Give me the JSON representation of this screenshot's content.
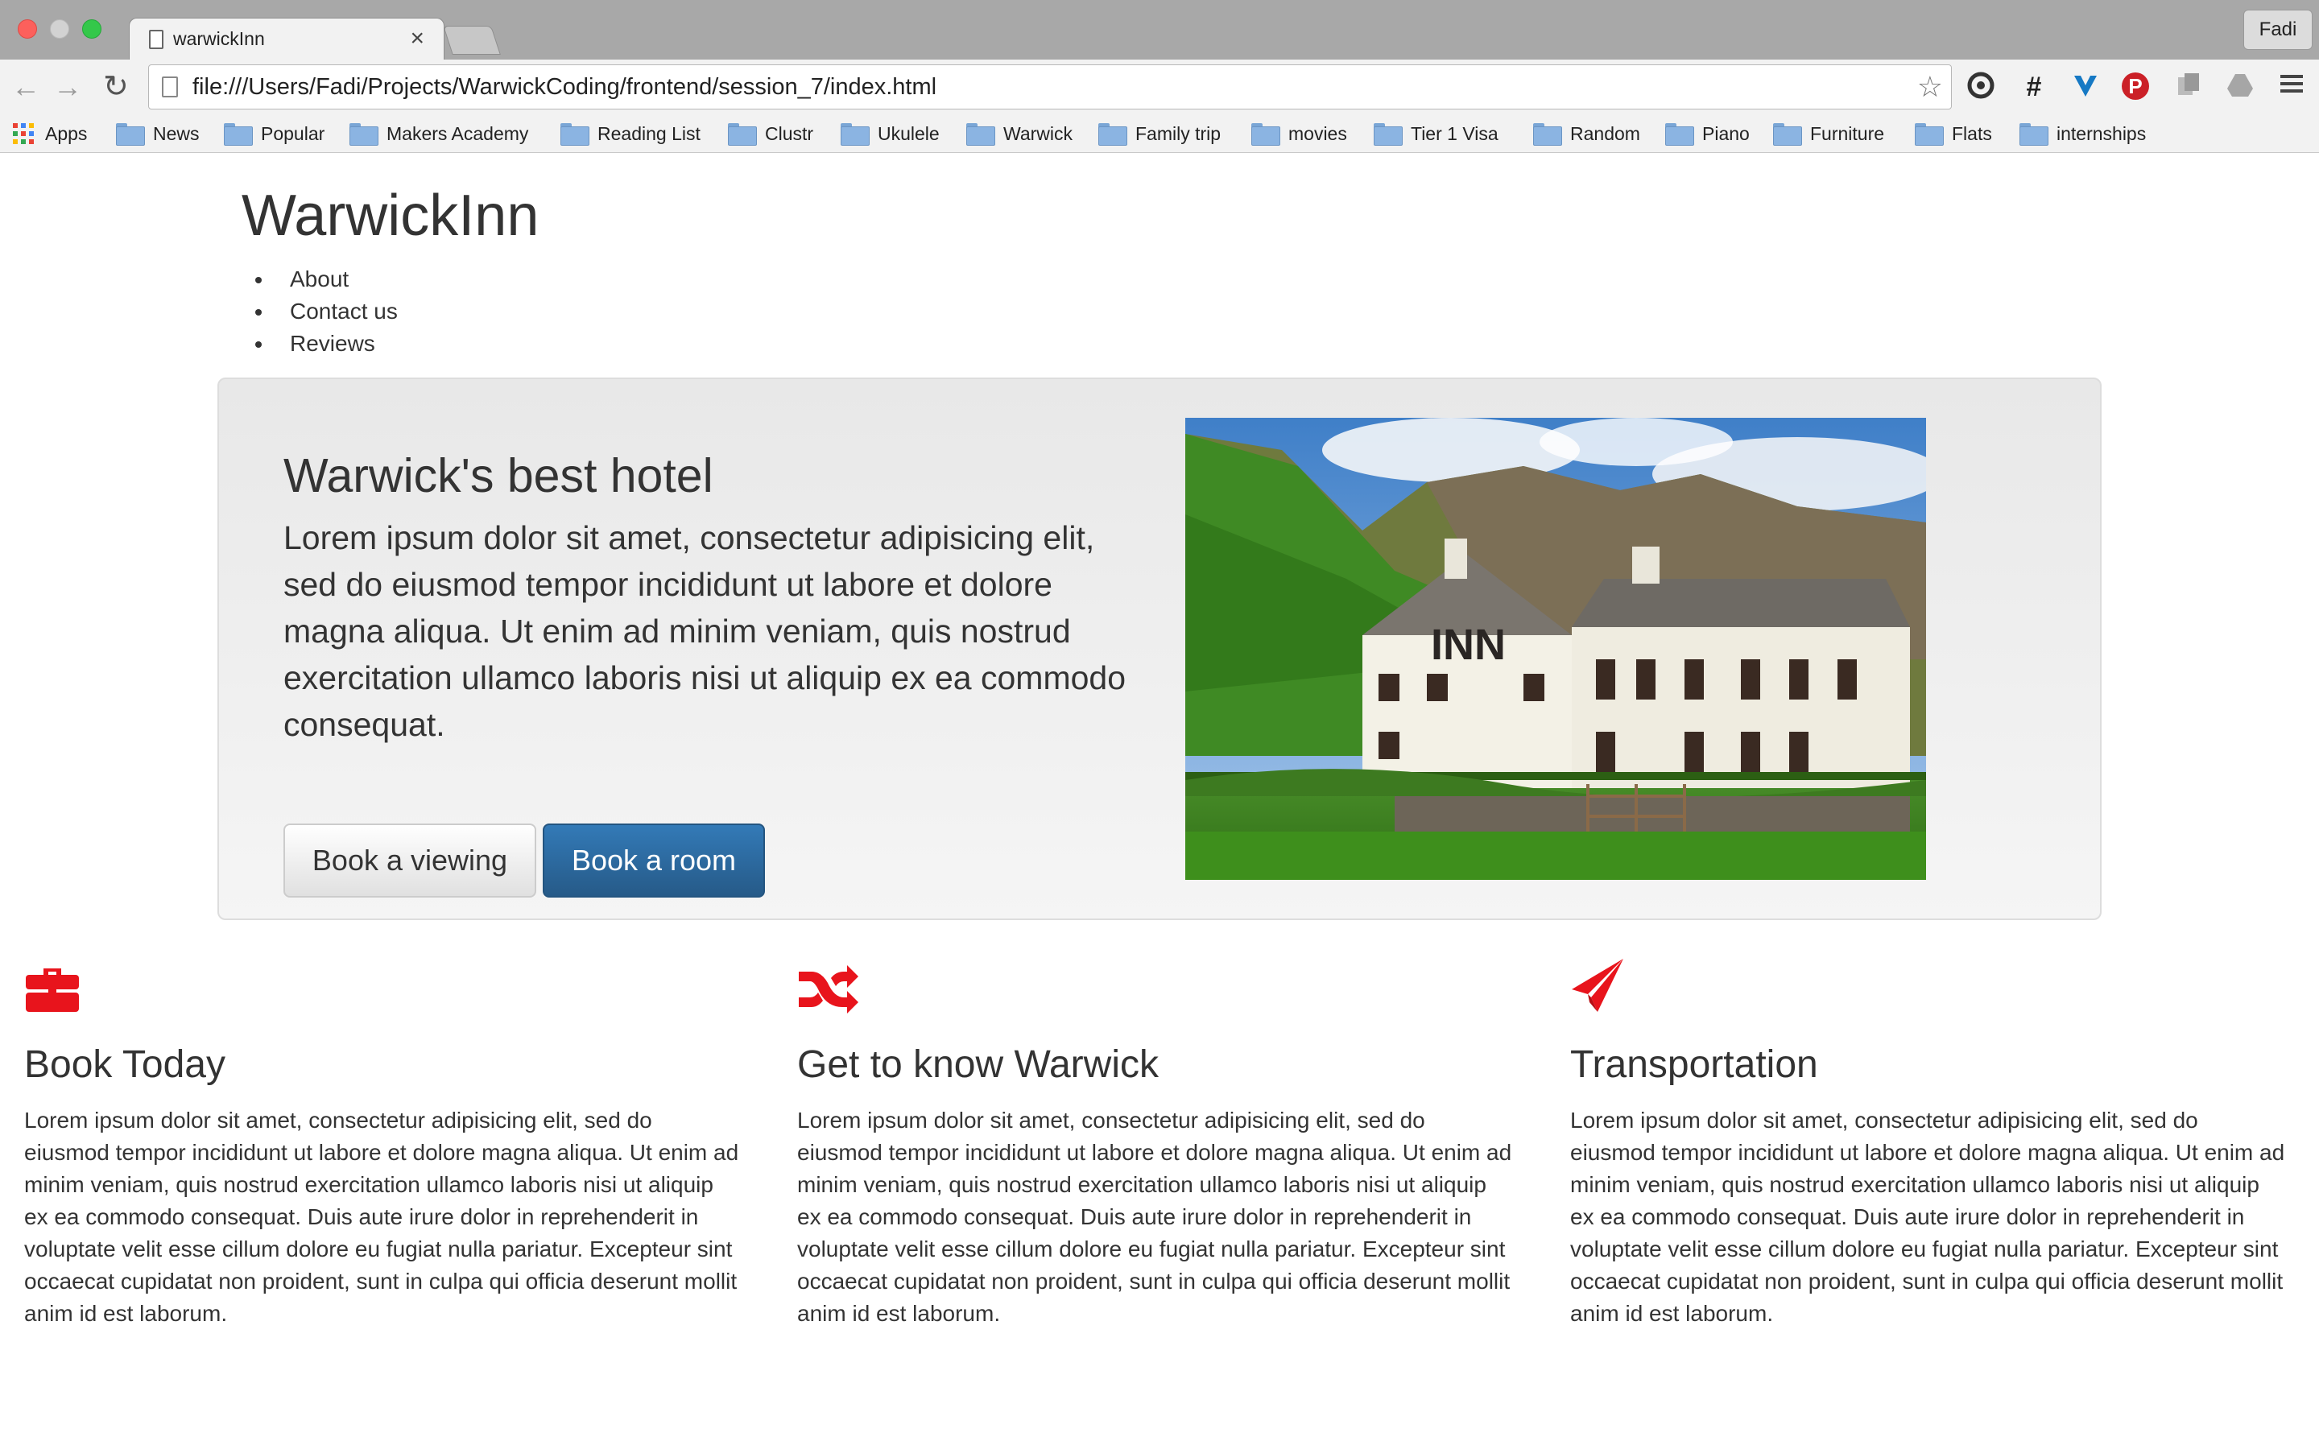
{
  "browser": {
    "tab_title": "warwickInn",
    "tab_close": "×",
    "profile_name": "Fadi",
    "url": "file:///Users/Fadi/Projects/WarwickCoding/frontend/session_7/index.html",
    "nav_icons": {
      "back": "←",
      "forward": "→",
      "reload": "↻",
      "star": "☆"
    },
    "extension_icons": [
      "circle-ext-icon",
      "hashtag-icon",
      "heart-ext-icon",
      "pinterest-icon",
      "copy-icon",
      "drive-icon",
      "menu-icon"
    ],
    "bookmarks": [
      "Apps",
      "News",
      "Popular",
      "Makers Academy",
      "Reading List",
      "Clustr",
      "Ukulele",
      "Warwick",
      "Family trip",
      "movies",
      "Tier 1 Visa",
      "Random",
      "Piano",
      "Furniture",
      "Flats",
      "internships"
    ]
  },
  "site": {
    "title": "WarwickInn",
    "nav": [
      "About",
      "Contact us",
      "Reviews"
    ]
  },
  "hero": {
    "heading": "Warwick's best hotel",
    "text": "Lorem ipsum dolor sit amet, consectetur adipisicing elit, sed do eiusmod tempor incididunt ut labore et dolore magna aliqua. Ut enim ad minim veniam, quis nostrud exercitation ullamco laboris nisi ut aliquip ex ea commodo consequat.",
    "btn_viewing": "Book a viewing",
    "btn_room": "Book a room",
    "image_sign": "INN"
  },
  "features": [
    {
      "icon": "briefcase-icon",
      "heading": "Book Today",
      "text": "Lorem ipsum dolor sit amet, consectetur adipisicing elit, sed do eiusmod tempor incididunt ut labore et dolore magna aliqua. Ut enim ad minim veniam, quis nostrud exercitation ullamco laboris nisi ut aliquip ex ea commodo consequat. Duis aute irure dolor in reprehenderit in voluptate velit esse cillum dolore eu fugiat nulla pariatur. Excepteur sint occaecat cupidatat non proident, sunt in culpa qui officia deserunt mollit anim id est laborum."
    },
    {
      "icon": "shuffle-icon",
      "heading": "Get to know Warwick",
      "text": "Lorem ipsum dolor sit amet, consectetur adipisicing elit, sed do eiusmod tempor incididunt ut labore et dolore magna aliqua. Ut enim ad minim veniam, quis nostrud exercitation ullamco laboris nisi ut aliquip ex ea commodo consequat. Duis aute irure dolor in reprehenderit in voluptate velit esse cillum dolore eu fugiat nulla pariatur. Excepteur sint occaecat cupidatat non proident, sunt in culpa qui officia deserunt mollit anim id est laborum."
    },
    {
      "icon": "send-icon",
      "heading": "Transportation",
      "text": "Lorem ipsum dolor sit amet, consectetur adipisicing elit, sed do eiusmod tempor incididunt ut labore et dolore magna aliqua. Ut enim ad minim veniam, quis nostrud exercitation ullamco laboris nisi ut aliquip ex ea commodo consequat. Duis aute irure dolor in reprehenderit in voluptate velit esse cillum dolore eu fugiat nulla pariatur. Excepteur sint occaecat cupidatat non proident, sunt in culpa qui officia deserunt mollit anim id est laborum."
    }
  ],
  "colors": {
    "accent_icon": "#e8141c",
    "primary_button": "#2d6ca2",
    "text": "#333333"
  }
}
